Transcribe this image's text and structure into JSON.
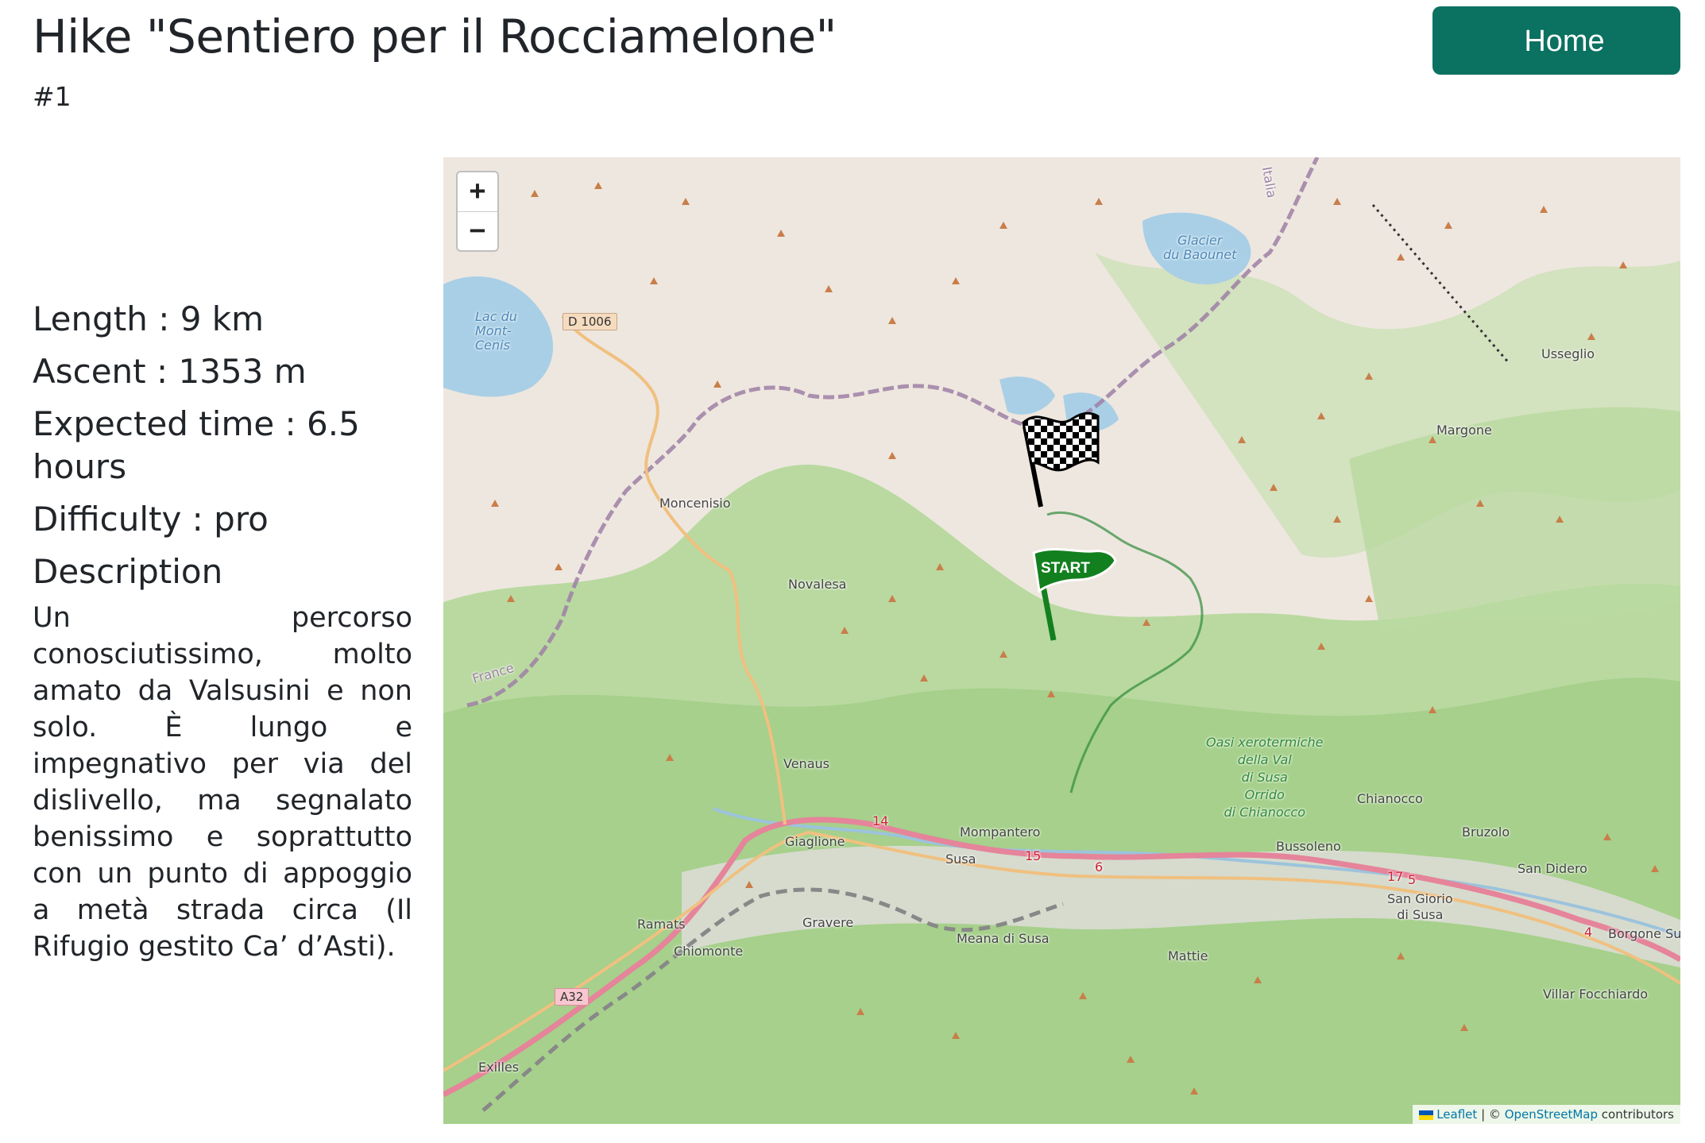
{
  "header": {
    "title": "Hike \"Sentiero per il Rocciamelone\"",
    "id_label": "#1",
    "home_label": "Home"
  },
  "info": {
    "length": "Length : 9 km",
    "ascent": "Ascent : 1353 m",
    "expected_time": "Expected time : 6.5 hours",
    "difficulty": "Difficulty : pro",
    "description_title": "Description",
    "description": "Un percorso conosciutissimo, molto amato da Valsusini e non solo. È lungo e impegnativo per via del dislivello, ma segnalato benissimo e soprattutto con un punto di appoggio a metà strada circa (Il Rifugio gestito Ca’ d’Asti)."
  },
  "map": {
    "zoom_in": "+",
    "zoom_out": "−",
    "attribution": {
      "leaflet": "Leaflet",
      "separator": "| ©",
      "osm": "OpenStreetMap",
      "contributors": "contributors"
    },
    "start_marker_label": "START",
    "places": {
      "moncenisio": "Moncenisio",
      "novalesa": "Novalesa",
      "venaus": "Venaus",
      "giaglione": "Giaglione",
      "mompantero": "Mompantero",
      "susa": "Susa",
      "gravere": "Gravere",
      "ramats": "Ramats",
      "chiomonte": "Chiomonte",
      "meana": "Meana di Susa",
      "mattie": "Mattie",
      "bussoleno": "Bussoleno",
      "chianocco": "Chianocco",
      "bruzolo": "Bruzolo",
      "san_didero": "San Didero",
      "san_giorio_1": "San Giorio",
      "san_giorio_2": "di Susa",
      "borgone": "Borgone Sus",
      "villar": "Villar Focchiardo",
      "exilles": "Exilles",
      "usseglio": "Usseglio",
      "margone": "Margone",
      "france": "France",
      "italia": "Italia",
      "lac_1": "Lac du",
      "lac_2": "Mont-",
      "lac_3": "Cenis",
      "glacier_1": "Glacier",
      "glacier_2": "du Baounet",
      "oasi_1": "Oasi xerotermiche",
      "oasi_2": "della Val",
      "oasi_3": "di Susa",
      "oasi_4": "Orrido",
      "oasi_5": "di Chianocco"
    },
    "roads": {
      "d1006": "D 1006",
      "a32": "A32",
      "r14": "14",
      "r15": "15",
      "r6": "6",
      "r17": "17",
      "r5": "5",
      "r4": "4"
    },
    "colors": {
      "land": "#eee7df",
      "forest": "#a6d08b",
      "water": "#a9cfe6",
      "trail": "#2f8a3a",
      "border": "#9e7fa6",
      "button": "#0b7161"
    }
  }
}
